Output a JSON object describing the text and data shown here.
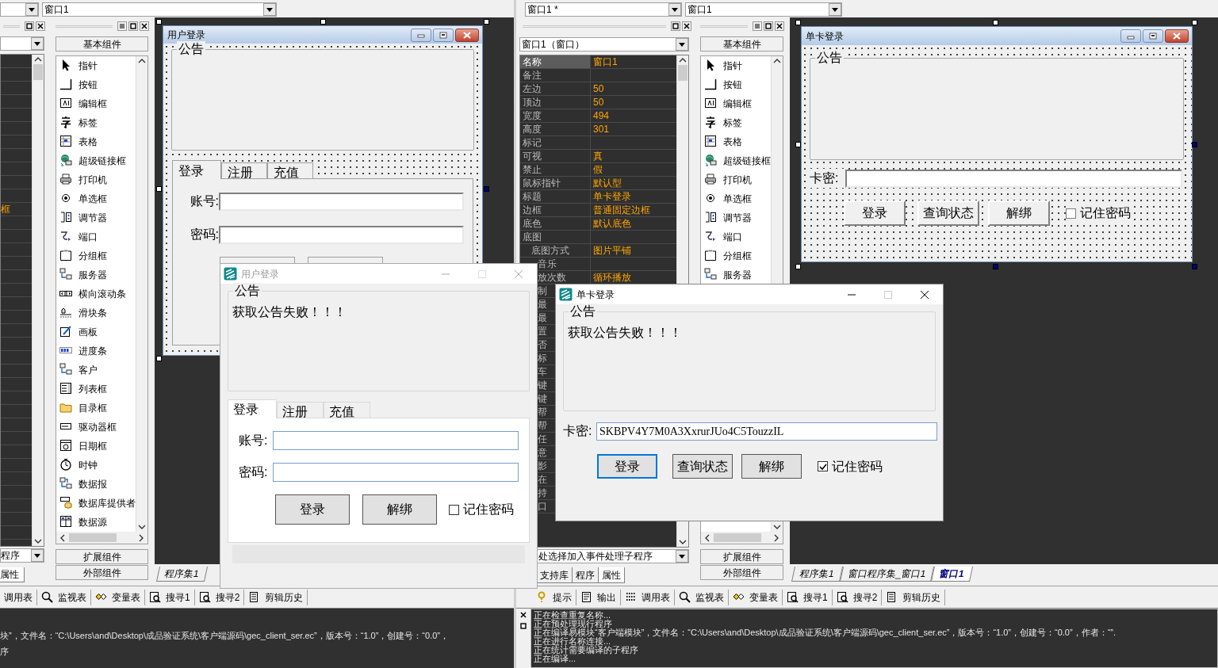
{
  "left_ide": {
    "window_combo": "窗口1",
    "property_panel": {
      "value_fragment": "框",
      "event_combo": "程序",
      "tab": "属性"
    },
    "palette": {
      "category": "基本组件",
      "items": [
        "指针",
        "按钮",
        "编辑框",
        "标签",
        "表格",
        "超级链接框",
        "打印机",
        "单选框",
        "调节器",
        "端口",
        "分组框",
        "服务器",
        "横向滚动条",
        "滑块条",
        "画板",
        "进度条",
        "客户",
        "列表框",
        "目录框",
        "驱动器框",
        "日期框",
        "时钟",
        "数据报",
        "数据库提供者",
        "数据源"
      ],
      "footer_buttons": [
        "扩展组件",
        "外部组件"
      ]
    },
    "designer_form": {
      "title": "用户登录",
      "group_title": "公告",
      "tabs": [
        {
          "label": "登录",
          "selected": true
        },
        {
          "label": "注册",
          "selected": false
        },
        {
          "label": "充值",
          "selected": false
        }
      ],
      "fields": [
        {
          "label": "账号:"
        },
        {
          "label": "密码:"
        }
      ]
    },
    "editor_tabs": [
      {
        "label": "程序集1",
        "selected": false
      }
    ],
    "output_tabs": [
      "调用表",
      "监视表",
      "变量表",
      "搜寻1",
      "搜寻2",
      "剪辑历史"
    ],
    "output_lines": [
      "块”，文件名：“C:\\Users\\and\\Desktop\\成品验证系统\\客户端源码\\gec_client_ser.ec”，版本号：“1.0”，创建号：“0.0”，",
      "序"
    ]
  },
  "right_ide": {
    "combos": [
      "窗口1 *",
      "窗口1"
    ],
    "property_panel": {
      "object_combo": "窗口1（窗口）",
      "rows": [
        {
          "name": "名称",
          "value": "窗口1",
          "selected": true
        },
        {
          "name": "备注",
          "selected": false
        },
        {
          "name": "左边",
          "value": "50",
          "selected": false
        },
        {
          "name": "顶边",
          "value": "50",
          "selected": false
        },
        {
          "name": "宽度",
          "value": "494",
          "selected": false
        },
        {
          "name": "高度",
          "value": "301",
          "selected": false
        },
        {
          "name": "标记",
          "selected": false
        },
        {
          "name": "可视",
          "value": "真",
          "selected": false
        },
        {
          "name": "禁止",
          "value": "假",
          "selected": false
        },
        {
          "name": "鼠标指针",
          "value": "默认型",
          "selected": false
        },
        {
          "name": "标题",
          "value": "单卡登录",
          "selected": false
        },
        {
          "name": "边框",
          "value": "普通固定边框",
          "selected": false
        },
        {
          "name": "底色",
          "value": "默认底色",
          "selected": false
        },
        {
          "name": "底图",
          "selected": false
        },
        {
          "name": "底图方式",
          "value": "图片平铺",
          "selected": false,
          "indent": true
        }
      ],
      "covered_rows": [
        {
          "name": "音乐"
        },
        {
          "name": "放次数",
          "value": "循环播放"
        },
        {
          "name": "制"
        },
        {
          "name": "最"
        },
        {
          "name": "最"
        },
        {
          "name": "置"
        },
        {
          "name": "否"
        },
        {
          "name": "标"
        },
        {
          "name": "车"
        },
        {
          "name": "键"
        },
        {
          "name": "键"
        },
        {
          "name": "帮"
        },
        {
          "name": "帮"
        },
        {
          "name": "任"
        },
        {
          "name": "意"
        },
        {
          "name": "影"
        },
        {
          "name": "在"
        },
        {
          "name": "持"
        },
        {
          "name": "口"
        }
      ],
      "event_combo": "处选择加入事件处理子程序",
      "tabs": [
        {
          "label": "支持库",
          "selected": false
        },
        {
          "label": "程序",
          "selected": false
        },
        {
          "label": "属性",
          "selected": true
        }
      ]
    },
    "palette": {
      "category": "基本组件",
      "items": [
        "指针",
        "按钮",
        "编辑框",
        "标签",
        "表格",
        "超级链接框",
        "打印机",
        "单选框",
        "调节器",
        "端口",
        "分组框",
        "服务器"
      ],
      "footer_buttons": [
        "扩展组件",
        "外部组件"
      ]
    },
    "designer_form": {
      "title": "单卡登录",
      "group_title": "公告",
      "field_label": "卡密:",
      "buttons": [
        "登录",
        "查询状态",
        "解绑"
      ],
      "checkbox": {
        "label": "记住密码",
        "checked": false
      }
    },
    "editor_tabs": [
      {
        "label": "程序集1",
        "selected": false
      },
      {
        "label": "窗口程序集_窗口1",
        "selected": false
      },
      {
        "label": "窗口1",
        "selected": true
      }
    ],
    "output_tabs": [
      "提示",
      "输出",
      "调用表",
      "监视表",
      "变量表",
      "搜寻1",
      "搜寻2",
      "剪辑历史"
    ],
    "output_lines": [
      "正在检查重复名称...",
      "正在预处理现行程序",
      "正在编译易模块“客户端模块”，文件名：“C:\\Users\\and\\Desktop\\成品验证系统\\客户端源码\\gec_client_ser.ec”，版本号：“1.0”，创建号：“0.0”，作者：“”.",
      "正在进行名称连接...",
      "正在统计需要编译的子程序",
      "正在编译..."
    ]
  },
  "dialogs": [
    {
      "kind": "tabbed_login",
      "title": "用户登录",
      "active": false,
      "group_title": "公告",
      "notice": "获取公告失败！！！",
      "tabs": [
        {
          "label": "登录",
          "selected": true
        },
        {
          "label": "注册",
          "selected": false
        },
        {
          "label": "充值",
          "selected": false
        }
      ],
      "fields": [
        {
          "label": "账号:"
        },
        {
          "label": "密码:"
        }
      ],
      "buttons": [
        {
          "label": "登录",
          "focused": false
        },
        {
          "label": "解绑",
          "focused": false
        }
      ],
      "checkbox": {
        "label": "记住密码",
        "checked": false
      }
    },
    {
      "kind": "card_login",
      "title": "单卡登录",
      "active": true,
      "group_title": "公告",
      "notice": "获取公告失败！！！",
      "field": {
        "label": "卡密:",
        "value": "SKBPV4Y7M0A3XxrurJUo4C5TouzzIL"
      },
      "buttons": [
        {
          "label": "登录",
          "focused": true
        },
        {
          "label": "查询状态",
          "focused": false
        },
        {
          "label": "解绑",
          "focused": false
        }
      ],
      "checkbox": {
        "label": "记住密码",
        "checked": true
      }
    }
  ]
}
